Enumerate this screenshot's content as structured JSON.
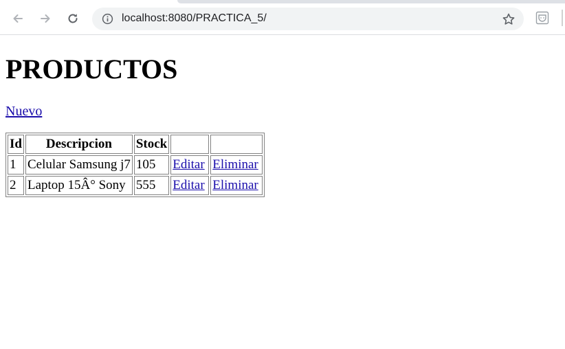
{
  "browser": {
    "url": "localhost:8080/PRACTICA_5/"
  },
  "page": {
    "title": "PRODUCTOS",
    "new_link": "Nuevo"
  },
  "table": {
    "headers": [
      "Id",
      "Descripcion",
      "Stock",
      "",
      ""
    ],
    "rows": [
      {
        "id": "1",
        "description": "Celular Samsung j7",
        "stock": "105",
        "edit": "Editar",
        "delete": "Eliminar"
      },
      {
        "id": "2",
        "description": "Laptop 15Â° Sony",
        "stock": "555",
        "edit": "Editar",
        "delete": "Eliminar"
      }
    ]
  },
  "icons": {
    "back": "arrow-left-icon",
    "forward": "arrow-right-icon",
    "reload": "reload-icon",
    "info": "info-icon",
    "bookmark": "star-icon",
    "extension": "extension-icon"
  },
  "colors": {
    "link": "#1a0dab",
    "omnibox_bg": "#f1f3f4"
  }
}
